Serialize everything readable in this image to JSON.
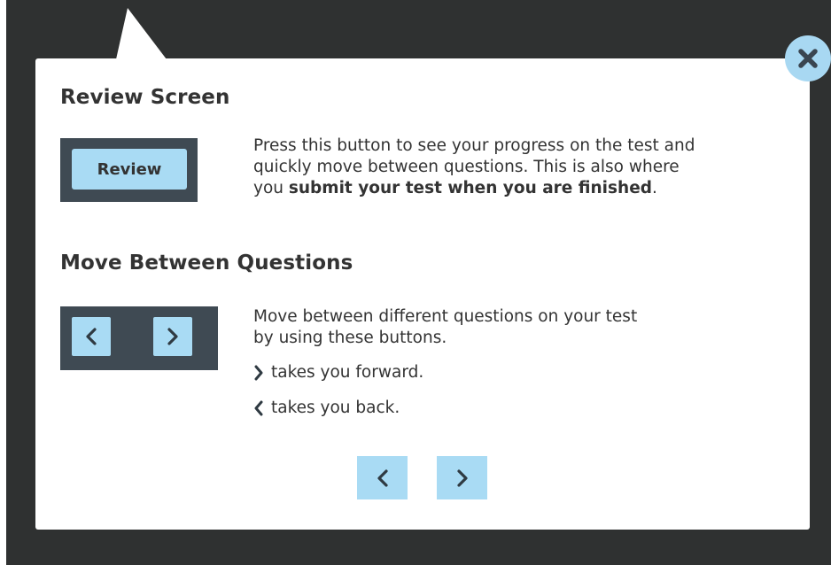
{
  "review_section": {
    "title": "Review Screen",
    "demo_button_label": "Review",
    "description_line1": "Press this button to see your progress on the test and",
    "description_line2": "quickly move between questions. This is also where",
    "description_line3_prefix": "you ",
    "description_line3_bold": "submit your test when you are finished",
    "description_line3_suffix": "."
  },
  "move_section": {
    "title": "Move Between Questions",
    "description_line1": "Move between different questions on your test",
    "description_line2": "by using these buttons.",
    "forward_text": "takes you forward.",
    "back_text": "takes you back."
  },
  "icons": {
    "close": "close-icon",
    "previous": "chevron-left-icon",
    "next": "chevron-right-icon"
  },
  "colors": {
    "overlay": "#2f3131",
    "button_fill": "#a9dbf4",
    "demo_panel": "#3f4a53",
    "text": "#333333"
  }
}
